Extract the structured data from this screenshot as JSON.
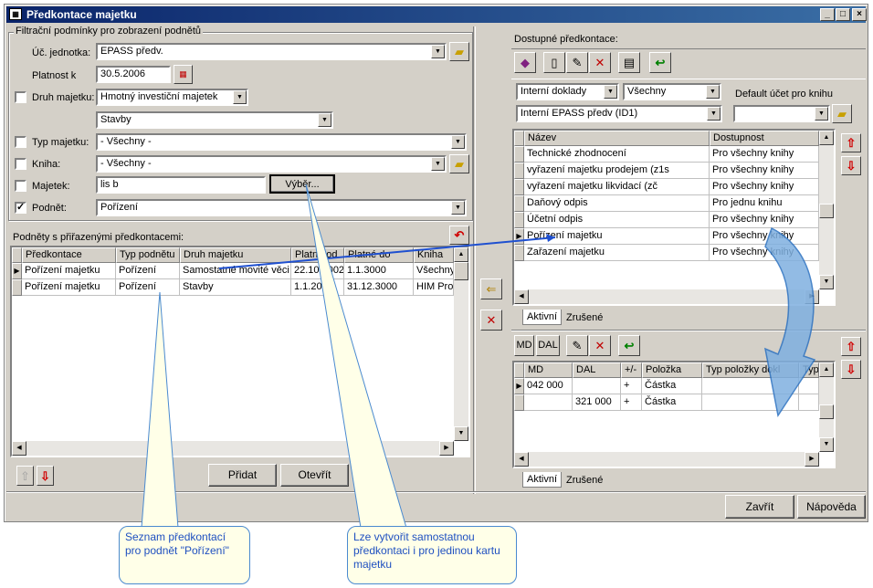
{
  "window": {
    "title": "Předkontace majetku",
    "min_btn": "_",
    "max_btn": "□",
    "close_btn": "×"
  },
  "filter": {
    "group_label": "Filtrační podmínky pro zobrazení podnětů",
    "uc_jednotka_label": "Úč. jednotka:",
    "uc_jednotka_value": "EPASS předv.",
    "platnost_label": "Platnost k",
    "platnost_value": "30.5.2006",
    "druh_label": "Druh majetku:",
    "druh_value": "Hmotný investiční majetek",
    "druh_sub_value": "Stavby",
    "typ_label": "Typ majetku:",
    "typ_value": "- Všechny -",
    "kniha_label": "Kniha:",
    "kniha_value": "- Všechny -",
    "majetek_label": "Majetek:",
    "majetek_value": "lis b",
    "vyber_label": "Výběr...",
    "podnet_label": "Podnět:",
    "podnet_value": "Pořízení",
    "podnet_checked": "✓"
  },
  "podnety": {
    "label": "Podněty s přiřazenými předkontacemi:",
    "columns": [
      "Předkontace",
      "Typ podnětu",
      "Druh majetku",
      "Platné od",
      "Platné do",
      "Kniha"
    ],
    "rows": [
      [
        "Pořízení majetku",
        "Pořízení",
        "Samostatné movité věci",
        "22.10.2002",
        "1.1.3000",
        "Všechny"
      ],
      [
        "Pořízení majetku",
        "Pořízení",
        "Stavby",
        "1.1.2006",
        "31.12.3000",
        "HIM Pro"
      ]
    ],
    "pridat_label": "Přidat",
    "otevrit_label": "Otevřít"
  },
  "dostupne": {
    "label": "Dostupné předkontace:",
    "doklady_value": "Interní doklady",
    "vsechny_value": "Všechny",
    "default_label": "Default účet pro knihu",
    "interni_value": "Interní EPASS předv (ID1)",
    "default_value": "",
    "columns": [
      "Název",
      "Dostupnost"
    ],
    "rows": [
      [
        "Technické zhodnocení",
        "Pro všechny knihy"
      ],
      [
        "vyřazení majetku prodejem (z1s",
        "Pro všechny knihy"
      ],
      [
        "vyřazení majetku likvidací (zč",
        "Pro všechny knihy"
      ],
      [
        "Daňový odpis",
        "Pro jednu knihu"
      ],
      [
        "Účetní odpis",
        "Pro všechny knihy"
      ],
      [
        "Pořízení majetku",
        "Pro všechny knihy"
      ],
      [
        "Zařazení majetku",
        "Pro všechny knihy"
      ]
    ],
    "tab_active": "Aktivní",
    "tab_cancelled": "Zrušené"
  },
  "ucty": {
    "md_btn": "MD",
    "dal_btn": "DAL",
    "columns": [
      "MD",
      "DAL",
      "+/-",
      "Položka",
      "Typ položky dokl",
      "Typ"
    ],
    "rows": [
      [
        "042 000",
        "",
        "+",
        "Částka",
        "",
        ""
      ],
      [
        "",
        "321 000",
        "+",
        "Částka",
        "",
        ""
      ]
    ],
    "tab_active": "Aktivní",
    "tab_cancelled": "Zrušené"
  },
  "footer": {
    "zavrit_label": "Zavřít",
    "napoveda_label": "Nápověda"
  },
  "callouts": {
    "left": "Seznam předkontací pro podnět \"Pořízení\"",
    "right": "Lze vytvořit samostatnou předkontaci i pro jedinou kartu majetku"
  }
}
